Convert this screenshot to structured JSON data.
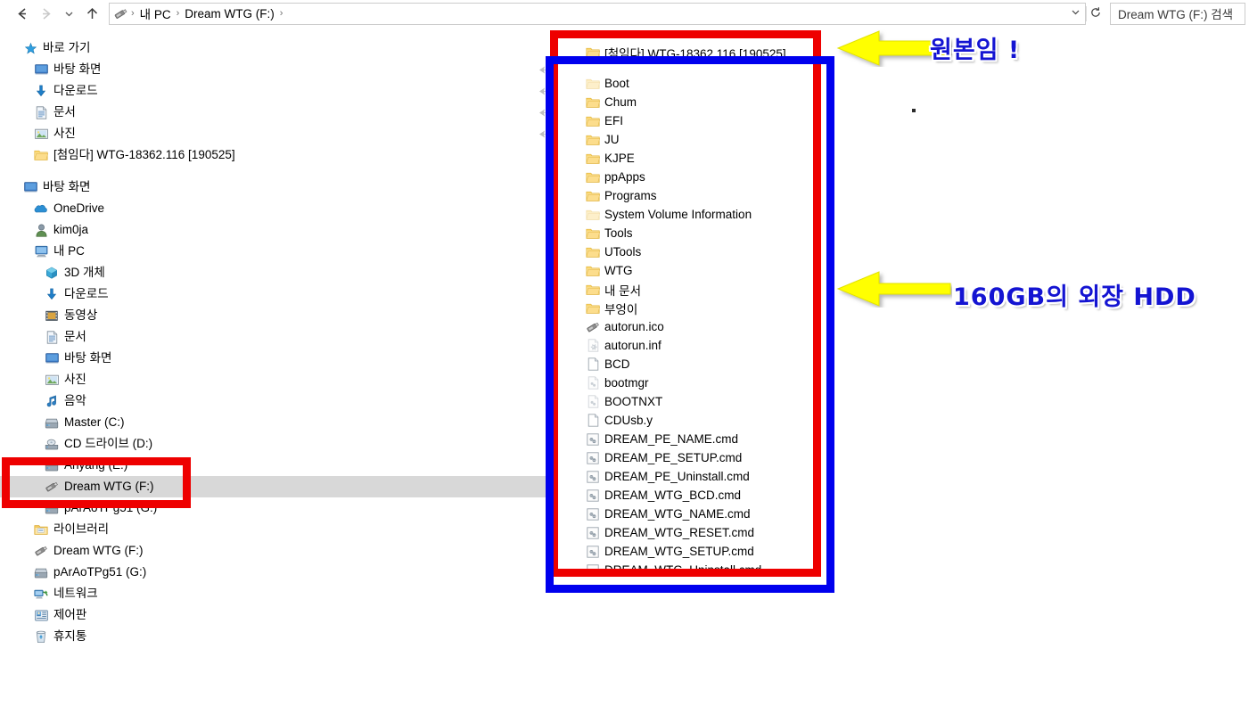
{
  "window": {
    "title": "Dream WTG (F:)"
  },
  "toolbar": {
    "back_icon": "arrow-left-icon",
    "forward_icon": "arrow-right-icon",
    "recent_icon": "chevron-down-icon",
    "up_icon": "arrow-up-icon",
    "refresh_icon": "refresh-icon",
    "dropdown_icon": "chevron-down-icon"
  },
  "address_bar": {
    "icon": "usb-drive-icon",
    "crumbs": [
      "내 PC",
      "Dream WTG (F:)"
    ],
    "separator": "›",
    "trailing_separator": "›"
  },
  "search": {
    "placeholder": "Dream WTG (F:) 검색",
    "icon": "search-icon"
  },
  "navpane": {
    "groups": [
      {
        "items": [
          {
            "label": "바로 가기",
            "icon": "pin-star-icon",
            "indent": 26,
            "selected": false
          },
          {
            "label": "바탕 화면",
            "icon": "desktop-icon",
            "indent": 38,
            "selected": false
          },
          {
            "label": "다운로드",
            "icon": "download-arrow-icon",
            "indent": 38,
            "selected": false
          },
          {
            "label": "문서",
            "icon": "documents-icon",
            "indent": 38,
            "selected": false
          },
          {
            "label": "사진",
            "icon": "pictures-icon",
            "indent": 38,
            "selected": false
          },
          {
            "label": "[첨임다] WTG-18362.116 [190525]",
            "icon": "folder-icon",
            "indent": 38,
            "selected": false
          }
        ]
      },
      {
        "items": [
          {
            "label": "바탕 화면",
            "icon": "desktop-icon",
            "indent": 26,
            "selected": false
          },
          {
            "label": "OneDrive",
            "icon": "onedrive-cloud-icon",
            "indent": 38,
            "selected": false
          },
          {
            "label": "kim0ja",
            "icon": "user-account-icon",
            "indent": 38,
            "selected": false
          },
          {
            "label": "내 PC",
            "icon": "this-pc-icon",
            "indent": 38,
            "selected": false
          },
          {
            "label": "3D 개체",
            "icon": "3d-objects-icon",
            "indent": 50,
            "selected": false
          },
          {
            "label": "다운로드",
            "icon": "download-arrow-icon",
            "indent": 50,
            "selected": false
          },
          {
            "label": "동영상",
            "icon": "videos-icon",
            "indent": 50,
            "selected": false
          },
          {
            "label": "문서",
            "icon": "documents-icon",
            "indent": 50,
            "selected": false
          },
          {
            "label": "바탕 화면",
            "icon": "desktop-icon",
            "indent": 50,
            "selected": false
          },
          {
            "label": "사진",
            "icon": "pictures-icon",
            "indent": 50,
            "selected": false
          },
          {
            "label": "음악",
            "icon": "music-note-icon",
            "indent": 50,
            "selected": false
          },
          {
            "label": "Master (C:)",
            "icon": "hard-drive-icon",
            "indent": 50,
            "selected": false
          },
          {
            "label": "CD 드라이브 (D:)",
            "icon": "cd-drive-icon",
            "indent": 50,
            "selected": false
          },
          {
            "label": "Anyang (E:)",
            "icon": "hard-drive-icon",
            "indent": 50,
            "selected": false
          },
          {
            "label": "Dream WTG (F:)",
            "icon": "usb-drive-icon",
            "indent": 50,
            "selected": true
          },
          {
            "label": "pArAoTPg51 (G:)",
            "icon": "hard-drive-icon",
            "indent": 50,
            "selected": false
          },
          {
            "label": "라이브러리",
            "icon": "libraries-icon",
            "indent": 38,
            "selected": false
          },
          {
            "label": "Dream WTG (F:)",
            "icon": "usb-drive-icon",
            "indent": 38,
            "selected": false
          },
          {
            "label": "pArAoTPg51 (G:)",
            "icon": "hard-drive-icon",
            "indent": 38,
            "selected": false
          },
          {
            "label": "네트워크",
            "icon": "network-icon",
            "indent": 38,
            "selected": false
          },
          {
            "label": "제어판",
            "icon": "control-panel-icon",
            "indent": 38,
            "selected": false
          },
          {
            "label": "휴지통",
            "icon": "recycle-bin-icon",
            "indent": 38,
            "selected": false
          }
        ]
      }
    ]
  },
  "filepane": {
    "items": [
      {
        "label": "[첨임다] WTG-18362.116 [190525]",
        "icon": "folder-icon",
        "dim": false
      },
      {
        "label": "Boot",
        "icon": "folder-icon",
        "dim": true
      },
      {
        "label": "Chum",
        "icon": "folder-icon",
        "dim": false
      },
      {
        "label": "EFI",
        "icon": "folder-icon",
        "dim": false
      },
      {
        "label": "JU",
        "icon": "folder-icon",
        "dim": false
      },
      {
        "label": "KJPE",
        "icon": "folder-icon",
        "dim": false
      },
      {
        "label": "ppApps",
        "icon": "folder-icon",
        "dim": false
      },
      {
        "label": "Programs",
        "icon": "folder-icon",
        "dim": false
      },
      {
        "label": "System Volume Information",
        "icon": "folder-icon",
        "dim": true
      },
      {
        "label": "Tools",
        "icon": "folder-icon",
        "dim": false
      },
      {
        "label": "UTools",
        "icon": "folder-icon",
        "dim": false
      },
      {
        "label": "WTG",
        "icon": "folder-icon",
        "dim": false
      },
      {
        "label": "내 문서",
        "icon": "folder-icon",
        "dim": false
      },
      {
        "label": "부엉이",
        "icon": "folder-icon",
        "dim": false
      },
      {
        "label": "autorun.ico",
        "icon": "usb-drive-icon",
        "dim": false
      },
      {
        "label": "autorun.inf",
        "icon": "config-file-icon",
        "dim": true
      },
      {
        "label": "BCD",
        "icon": "blank-file-icon",
        "dim": false
      },
      {
        "label": "bootmgr",
        "icon": "system-file-icon",
        "dim": true
      },
      {
        "label": "BOOTNXT",
        "icon": "system-file-icon",
        "dim": true
      },
      {
        "label": "CDUsb.y",
        "icon": "blank-file-icon",
        "dim": false
      },
      {
        "label": "DREAM_PE_NAME.cmd",
        "icon": "cmd-script-icon",
        "dim": false
      },
      {
        "label": "DREAM_PE_SETUP.cmd",
        "icon": "cmd-script-icon",
        "dim": false
      },
      {
        "label": "DREAM_PE_Uninstall.cmd",
        "icon": "cmd-script-icon",
        "dim": false
      },
      {
        "label": "DREAM_WTG_BCD.cmd",
        "icon": "cmd-script-icon",
        "dim": false
      },
      {
        "label": "DREAM_WTG_NAME.cmd",
        "icon": "cmd-script-icon",
        "dim": false
      },
      {
        "label": "DREAM_WTG_RESET.cmd",
        "icon": "cmd-script-icon",
        "dim": false
      },
      {
        "label": "DREAM_WTG_SETUP.cmd",
        "icon": "cmd-script-icon",
        "dim": false
      },
      {
        "label": "DREAM_WTG_Uninstall.cmd",
        "icon": "cmd-script-icon",
        "dim": false
      }
    ]
  },
  "annotations": {
    "callouts": [
      {
        "text": "원본임 !",
        "arrow": "left-arrow-icon"
      },
      {
        "text": "160GB의 외장 HDD",
        "arrow": "left-arrow-icon"
      }
    ],
    "colors": {
      "highlight_red": "#ee0000",
      "highlight_blue": "#0000ee",
      "arrow_yellow": "#ffff00",
      "text_blue": "#1414d2"
    }
  }
}
